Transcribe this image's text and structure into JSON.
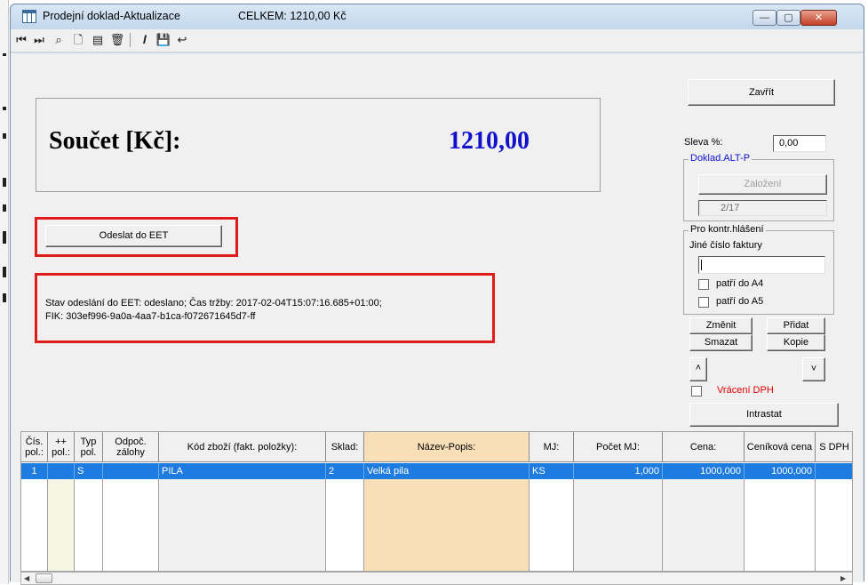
{
  "window": {
    "title": "Prodejní doklad-Aktualizace",
    "total_caption": "CELKEM: 1210,00 Kč",
    "min_glyph": "—",
    "max_glyph": "▢",
    "close_glyph": "✕"
  },
  "toolbar": {
    "icons": [
      "first-record-icon",
      "last-record-icon",
      "search-icon",
      "new-document-icon",
      "list-icon",
      "delete-icon",
      "italic-edit-icon",
      "save-icon",
      "return-icon"
    ],
    "glyphs": [
      "⏮",
      "⏭",
      "⌕",
      "🗋",
      "▤",
      "🗑",
      "𝑰",
      "💾",
      "↩"
    ]
  },
  "sum": {
    "label": "Součet [Kč]:",
    "value": "1210,00",
    "value_color": "#1111cc"
  },
  "eet": {
    "send_button": "Odeslat do EET",
    "status_line1": "Stav odeslání do EET: odeslano; Čas tržby: 2017-02-04T15:07:16.685+01:00;",
    "status_line2": "FIK: 303ef996-9a0a-4aa7-b1ca-f072671645d7-ff",
    "highlight_color": "#e01b1b"
  },
  "right": {
    "close_button": "Zavřít",
    "discount_label": "Sleva %:",
    "discount_value": "0,00",
    "doc_group_label": "Doklad.ALT-P",
    "create_button": "Založení",
    "record_counter": "2/17",
    "report_group_label": "Pro kontr.hlášení",
    "invoice_no_label": "Jiné číslo faktury",
    "invoice_no_value": "",
    "a4_label": "patří do A4",
    "a5_label": "patří do A5",
    "change_button": "Změnit",
    "add_button": "Přidat",
    "delete_button": "Smazat",
    "copy_button": "Kopie",
    "up_button": "˄",
    "down_button": "˅",
    "vat_refund_label": "Vrácení DPH",
    "intrastat_button": "Intrastat"
  },
  "grid": {
    "columns": [
      {
        "label": "Čís. pol.:"
      },
      {
        "label": "++ pol.:"
      },
      {
        "label": "Typ pol."
      },
      {
        "label": "Odpoč. zálohy"
      },
      {
        "label": "Kód zboží (fakt. položky):"
      },
      {
        "label": "Sklad:"
      },
      {
        "label": "Název-Popis:"
      },
      {
        "label": "MJ:"
      },
      {
        "label": "Počet MJ:"
      },
      {
        "label": "Cena:"
      },
      {
        "label": "Ceníková cena"
      },
      {
        "label": "S DPH"
      }
    ],
    "rows": [
      [
        "1",
        "",
        "S",
        "",
        "PILA",
        "2",
        "Velká pila",
        "KS",
        "1,000",
        "1000,000",
        "1000,000",
        ""
      ]
    ]
  },
  "scrollbar": {
    "left_arrow": "◀",
    "right_arrow": "▶"
  }
}
